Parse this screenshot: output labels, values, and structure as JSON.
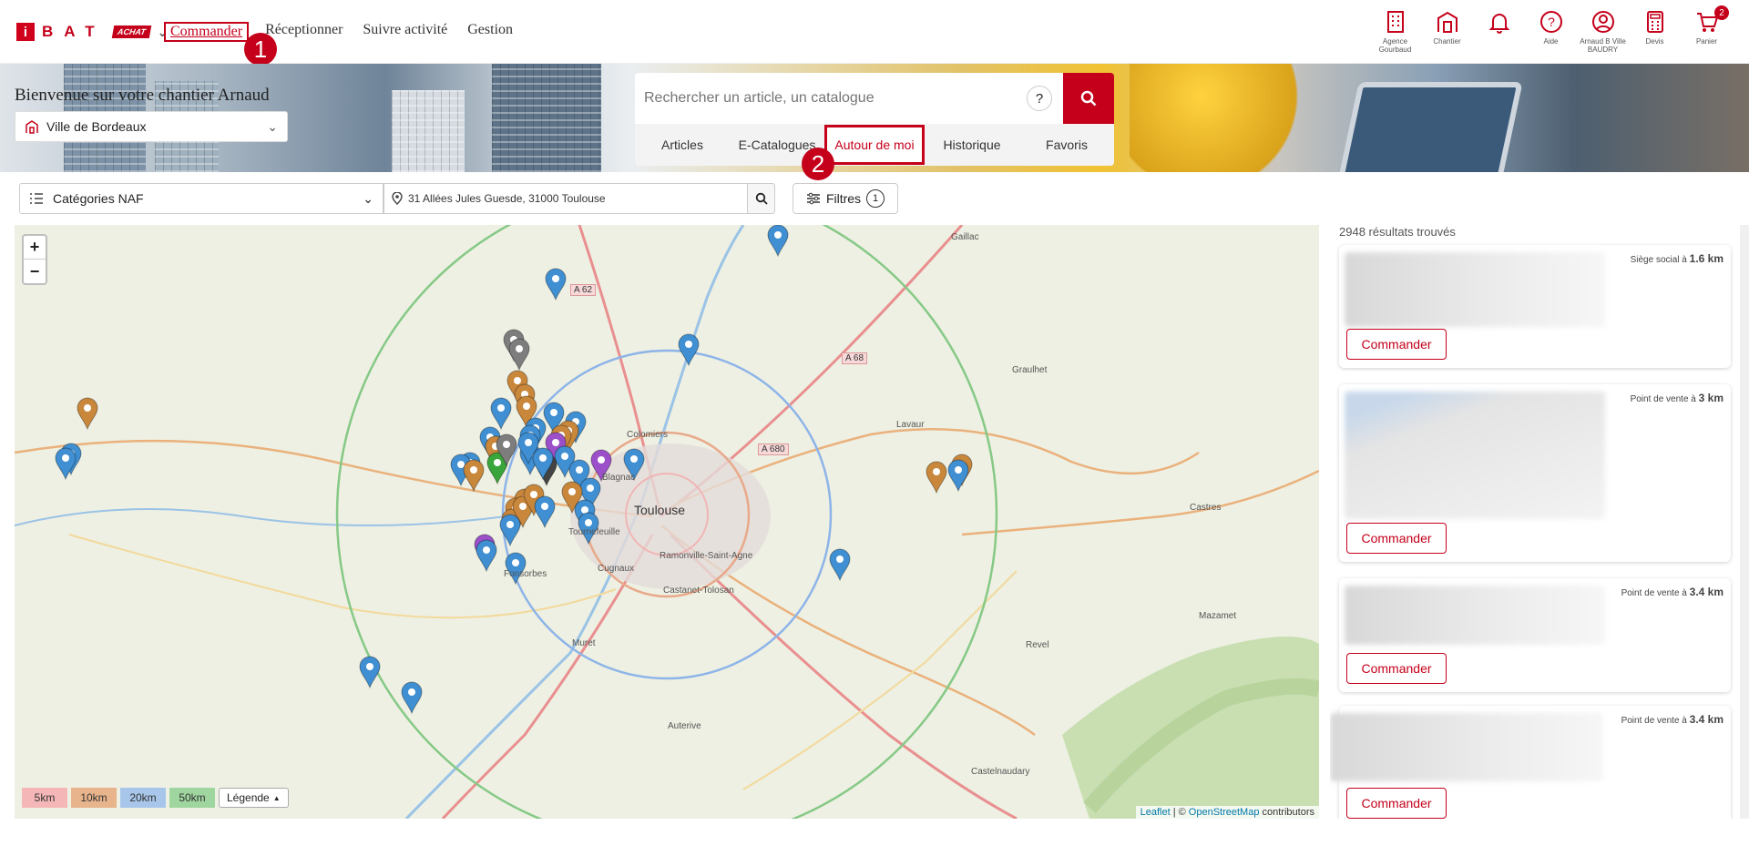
{
  "header": {
    "brand_letters": "BAT",
    "brand_i": "i",
    "brand_tag": "ACHAT",
    "nav": [
      "Commander",
      "Réceptionner",
      "Suivre activité",
      "Gestion"
    ],
    "icons": [
      {
        "name": "agence-icon",
        "label": "Agence Gourbaud"
      },
      {
        "name": "chantier-icon",
        "label": "Chantier"
      },
      {
        "name": "bell-icon",
        "label": ""
      },
      {
        "name": "help-icon",
        "label": "Aide"
      },
      {
        "name": "user-icon",
        "label": "Arnaud B Ville BAUDRY"
      },
      {
        "name": "calculator-icon",
        "label": "Devis"
      },
      {
        "name": "cart-icon",
        "label": "Panier"
      }
    ],
    "cart_badge": "2"
  },
  "callouts": [
    "1",
    "2"
  ],
  "banner": {
    "welcome": "Bienvenue sur votre chantier Arnaud",
    "site": "Ville de Bordeaux"
  },
  "search": {
    "placeholder": "Rechercher un article, un catalogue",
    "help": "?",
    "tabs": [
      "Articles",
      "E-Catalogues",
      "Autour de moi",
      "Historique",
      "Favoris"
    ]
  },
  "filters": {
    "categories": "Catégories NAF",
    "address": "31 Allées Jules Guesde, 31000 Toulouse",
    "filters_label": "Filtres",
    "filters_count": "1"
  },
  "map": {
    "zoom_in": "+",
    "zoom_out": "−",
    "radius_labels": [
      "5km",
      "10km",
      "20km",
      "50km"
    ],
    "radius_colors": [
      "#f4b6b6",
      "#e8b48c",
      "#a7c6ea",
      "#9fd69f"
    ],
    "legend_label": "Légende",
    "attribution_leaflet": "Leaflet",
    "attribution_osm": "OpenStreetMap",
    "attribution_rest": "contributors",
    "places": [
      "Toulouse",
      "Tournefeuille",
      "Colomiers",
      "Blagnac",
      "Ramonville-Saint-Agne",
      "Castanet-Tolosan",
      "Cugnaux",
      "Fonsorbes",
      "Muret",
      "Auterive",
      "Revel",
      "Lavaur",
      "Graulhet",
      "Castres",
      "Mazamet",
      "Castelnaudary",
      "Gaillac"
    ],
    "roads": [
      "A 62",
      "A 68",
      "A 680"
    ],
    "pin_colors": {
      "blue": "#3f8fd2",
      "orange": "#c9873b",
      "gray": "#7d7d7d",
      "purple": "#9b4fc9",
      "green": "#3aa53a",
      "dark": "#444444"
    }
  },
  "results": {
    "count_text": "2948 résultats trouvés",
    "items": [
      {
        "type": "Siège social à",
        "distance": "1.6 km",
        "button": "Commander"
      },
      {
        "type": "Point de vente à",
        "distance": "3 km",
        "button": "Commander"
      },
      {
        "type": "Point de vente à",
        "distance": "3.4 km",
        "button": "Commander"
      },
      {
        "type": "Point de vente à",
        "distance": "3.4 km",
        "button": "Commander"
      }
    ]
  }
}
